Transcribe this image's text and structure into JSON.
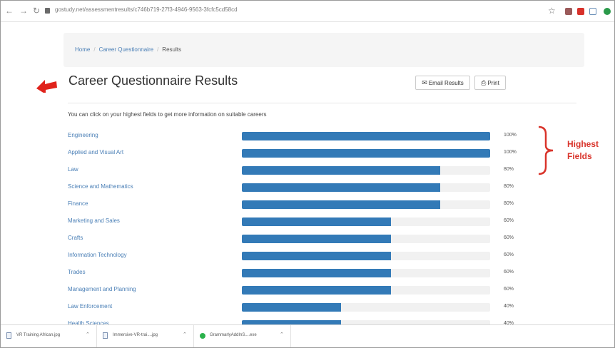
{
  "browser": {
    "url": "gostudy.net/assessmentresults/c746b719-27f3-4946-9563-3fcfc5cd58cd"
  },
  "breadcrumb": {
    "home": "Home",
    "section": "Career Questionnaire",
    "current": "Results"
  },
  "page": {
    "title": "Career Questionnaire Results",
    "email_label": "Email Results",
    "print_label": "Print",
    "intro": "You can click on your highest fields to get more information on suitable careers"
  },
  "results": [
    {
      "field": "Engineering",
      "percent_label": "100%",
      "value": 100
    },
    {
      "field": "Applied and Visual Art",
      "percent_label": "100%",
      "value": 100
    },
    {
      "field": "Law",
      "percent_label": "80%",
      "value": 80
    },
    {
      "field": "Science and Mathematics",
      "percent_label": "80%",
      "value": 80
    },
    {
      "field": "Finance",
      "percent_label": "80%",
      "value": 80
    },
    {
      "field": "Marketing and Sales",
      "percent_label": "60%",
      "value": 60
    },
    {
      "field": "Crafts",
      "percent_label": "60%",
      "value": 60
    },
    {
      "field": "Information Technology",
      "percent_label": "60%",
      "value": 60
    },
    {
      "field": "Trades",
      "percent_label": "60%",
      "value": 60
    },
    {
      "field": "Management and Planning",
      "percent_label": "60%",
      "value": 60
    },
    {
      "field": "Law Enforcement",
      "percent_label": "40%",
      "value": 40
    },
    {
      "field": "Health Sciences",
      "percent_label": "40%",
      "value": 40
    }
  ],
  "annotation": {
    "text": "Highest\nFields"
  },
  "downloads": [
    {
      "name": "VR Training African.jpg",
      "icon": "image-file-icon"
    },
    {
      "name": "Immersive-VR-trai....jpg",
      "icon": "image-file-icon"
    },
    {
      "name": "GrammarlyAddInS....exe",
      "icon": "grammarly-icon"
    }
  ],
  "colors": {
    "bar": "#337ab7",
    "link": "#4a7fb6",
    "annotation": "#d9342b"
  }
}
